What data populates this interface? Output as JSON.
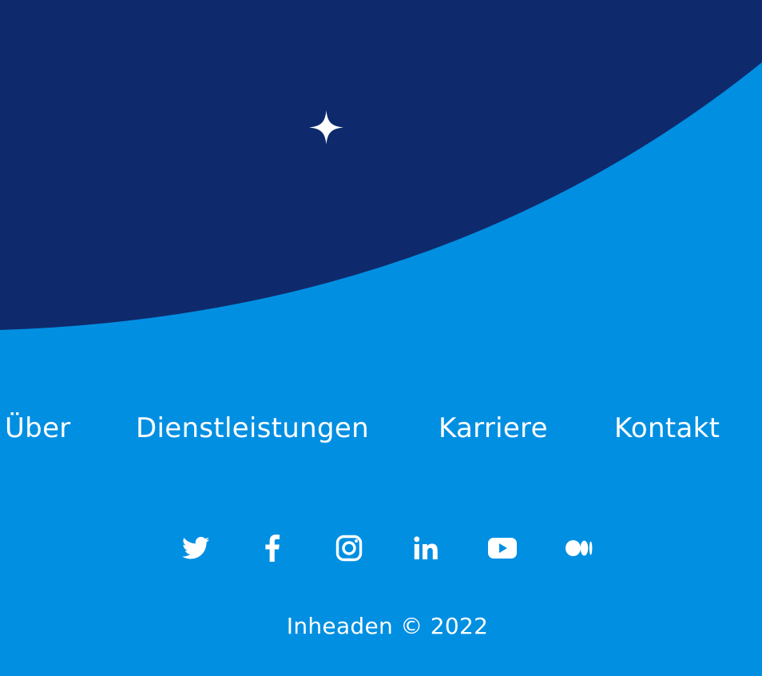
{
  "colors": {
    "dark_navy": "#0e2a6c",
    "bright_blue": "#018fe2",
    "text": "#ffffff"
  },
  "hero": {
    "decoration_icon": "sparkle-icon"
  },
  "footer": {
    "nav": [
      {
        "label": "Über"
      },
      {
        "label": "Dienstleistungen"
      },
      {
        "label": "Karriere"
      },
      {
        "label": "Kontakt"
      }
    ],
    "social": [
      {
        "icon": "twitter-icon"
      },
      {
        "icon": "facebook-icon"
      },
      {
        "icon": "instagram-icon"
      },
      {
        "icon": "linkedin-icon"
      },
      {
        "icon": "youtube-icon"
      },
      {
        "icon": "medium-icon"
      }
    ],
    "copyright": "Inheaden © 2022"
  }
}
